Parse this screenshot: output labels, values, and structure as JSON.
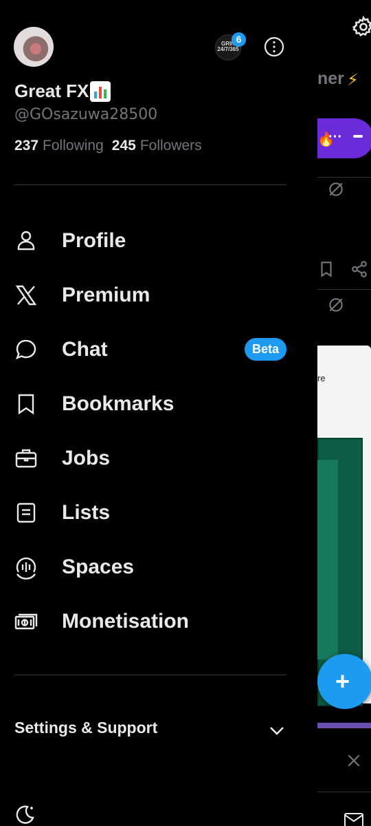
{
  "profile": {
    "display_name": "Great FX",
    "handle": "@GOsazuwa28500",
    "following_count": "237",
    "following_label": "Following",
    "followers_count": "245",
    "followers_label": "Followers",
    "name_emoji": "bar-chart-emoji"
  },
  "accounts": {
    "switch_badge_count": "6",
    "switch_avatar_text": "GRIN 24/7/365"
  },
  "menu": {
    "items": [
      {
        "label": "Profile",
        "icon": "person-icon"
      },
      {
        "label": "Premium",
        "icon": "x-logo-icon"
      },
      {
        "label": "Chat",
        "icon": "chat-bubble-icon",
        "badge": "Beta"
      },
      {
        "label": "Bookmarks",
        "icon": "bookmark-icon"
      },
      {
        "label": "Jobs",
        "icon": "briefcase-icon"
      },
      {
        "label": "Lists",
        "icon": "list-icon"
      },
      {
        "label": "Spaces",
        "icon": "spaces-icon"
      },
      {
        "label": "Monetisation",
        "icon": "money-icon"
      }
    ]
  },
  "settings": {
    "label": "Settings & Support"
  },
  "background": {
    "tab_text": "ner",
    "card_text": "re",
    "fab_symbol": "+"
  },
  "colors": {
    "accent": "#1d9bf0",
    "background": "#000000",
    "text_primary": "#e7e9ea",
    "text_secondary": "#71767b",
    "divider": "#2f3336"
  }
}
